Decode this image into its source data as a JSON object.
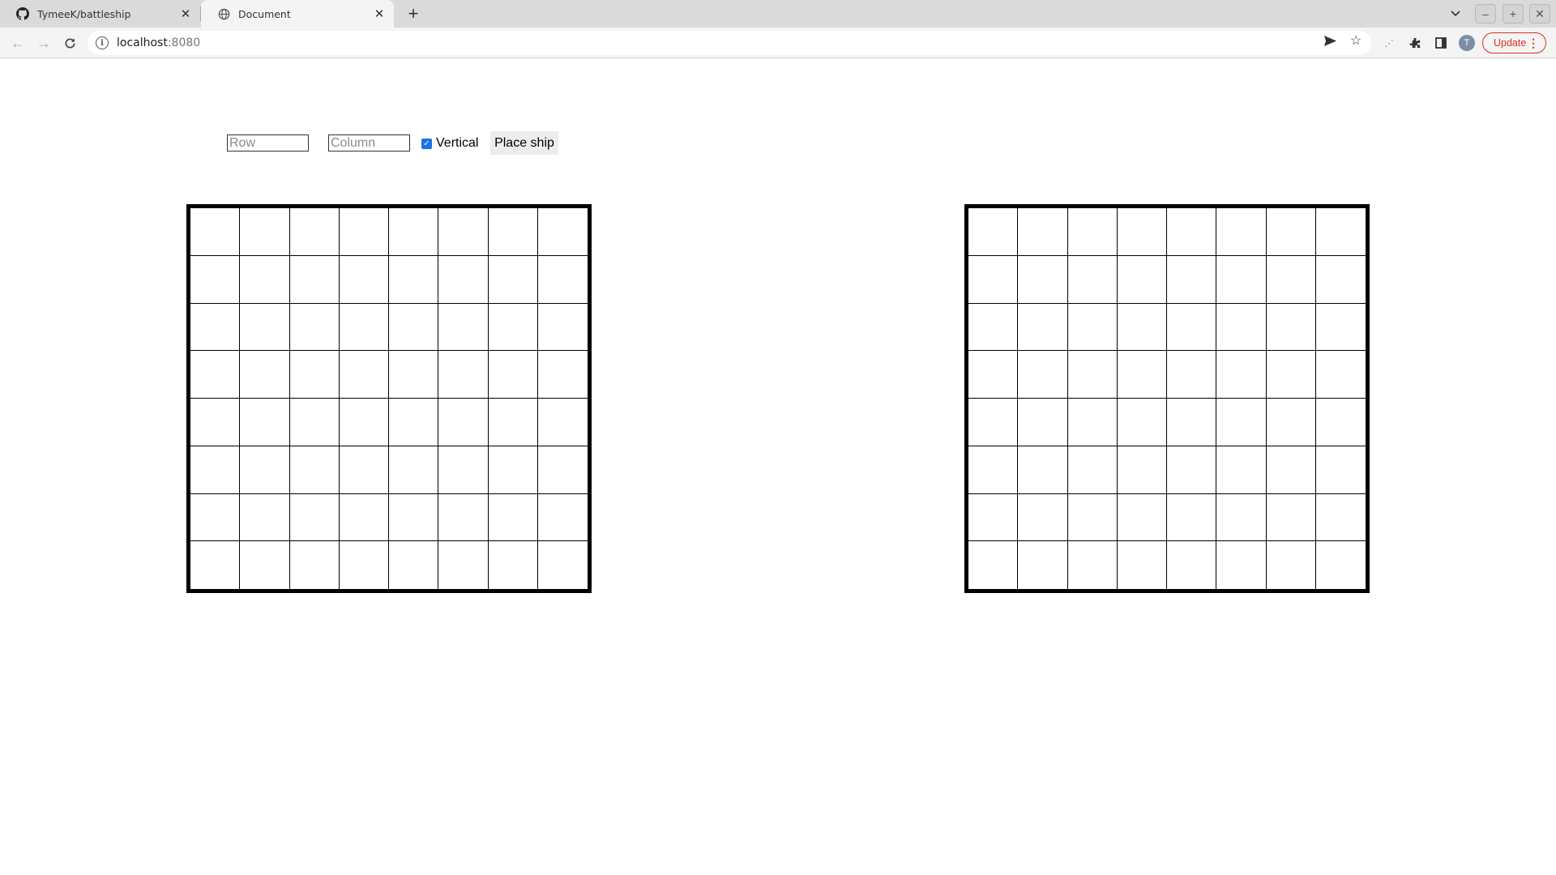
{
  "browser": {
    "tabs": [
      {
        "title": "TymeeK/battleship",
        "icon": "github-icon",
        "active": false
      },
      {
        "title": "Document",
        "icon": "globe-icon",
        "active": true
      }
    ],
    "address": {
      "host": "localhost",
      "port": ":8080"
    },
    "profile_initial": "T",
    "update_label": "Update"
  },
  "page": {
    "controls": {
      "row_placeholder": "Row",
      "column_placeholder": "Column",
      "vertical_label": "Vertical",
      "vertical_checked": true,
      "place_ship_label": "Place ship"
    },
    "boards": [
      {
        "name": "player-board",
        "rows": 8,
        "cols": 8
      },
      {
        "name": "opponent-board",
        "rows": 8,
        "cols": 8
      }
    ]
  },
  "colors": {
    "accent": "#1a73e8",
    "update_red": "#d93025",
    "grid_line": "#000000"
  }
}
